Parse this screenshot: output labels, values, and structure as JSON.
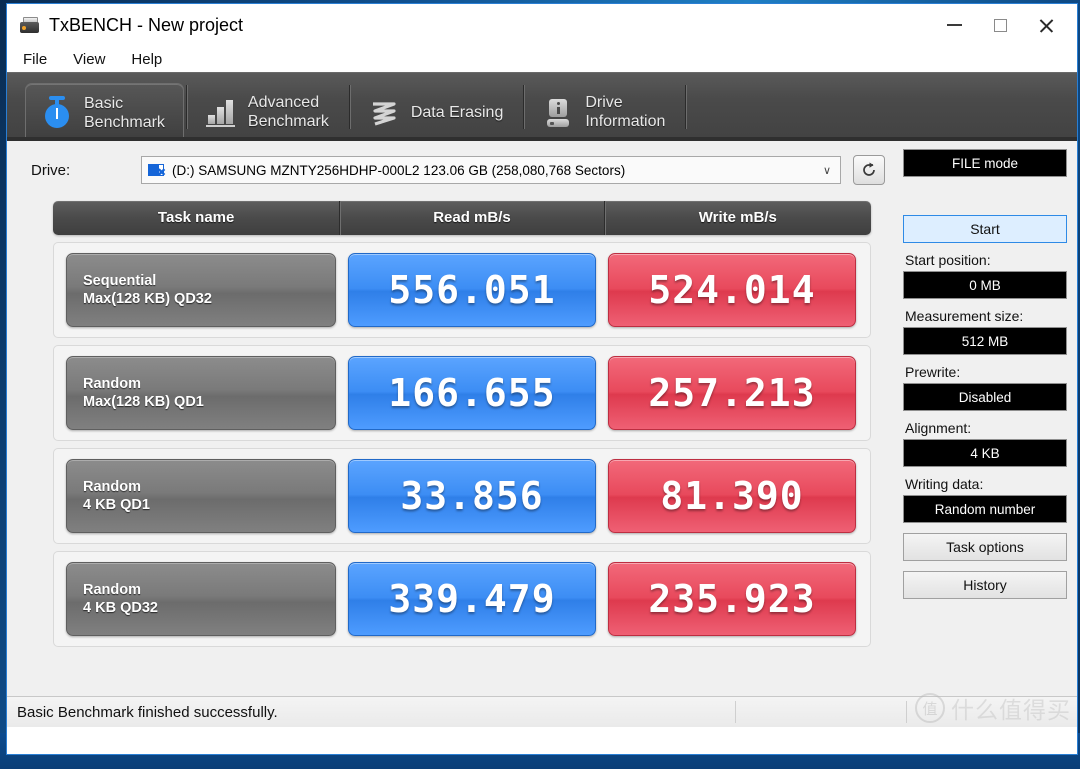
{
  "window": {
    "title": "TxBENCH - New project",
    "app_icon": "drive-icon",
    "controls": {
      "minimize": "minimize-icon",
      "maximize": "maximize-icon",
      "close": "close-icon"
    }
  },
  "menubar": {
    "items": [
      "File",
      "View",
      "Help"
    ]
  },
  "tabs": [
    {
      "label": "Basic\nBenchmark",
      "icon": "stopwatch-icon",
      "active": true
    },
    {
      "label": "Advanced\nBenchmark",
      "icon": "bar-chart-icon",
      "active": false
    },
    {
      "label": "Data Erasing",
      "icon": "erase-icon",
      "active": false
    },
    {
      "label": "Drive\nInformation",
      "icon": "drive-info-icon",
      "active": false
    }
  ],
  "drive": {
    "label": "Drive:",
    "selected": "(D:) SAMSUNG MZNTY256HDHP-000L2  123.06 GB (258,080,768 Sectors)",
    "caret": "∨",
    "refresh_icon": "refresh-icon"
  },
  "table": {
    "headers": [
      "Task name",
      "Read mB/s",
      "Write mB/s"
    ],
    "rows": [
      {
        "name_line1": "Sequential",
        "name_line2": "Max(128 KB) QD32",
        "read": "556.051",
        "write": "524.014"
      },
      {
        "name_line1": "Random",
        "name_line2": "Max(128 KB) QD1",
        "read": "166.655",
        "write": "257.213"
      },
      {
        "name_line1": "Random",
        "name_line2": "4 KB QD1",
        "read": "33.856",
        "write": "81.390"
      },
      {
        "name_line1": "Random",
        "name_line2": "4 KB QD32",
        "read": "339.479",
        "write": "235.923"
      }
    ]
  },
  "sidebar": {
    "file_mode": "FILE mode",
    "start": "Start",
    "fields": [
      {
        "label": "Start position:",
        "value": "0 MB"
      },
      {
        "label": "Measurement size:",
        "value": "512 MB"
      },
      {
        "label": "Prewrite:",
        "value": "Disabled"
      },
      {
        "label": "Alignment:",
        "value": "4 KB"
      },
      {
        "label": "Writing data:",
        "value": "Random number"
      }
    ],
    "task_options": "Task options",
    "history": "History"
  },
  "statusbar": {
    "message": "Basic Benchmark finished successfully."
  },
  "watermark": {
    "badge": "值",
    "text": "什么值得买"
  },
  "colors": {
    "read_bar": "#3c8df4",
    "write_bar": "#e8495c",
    "accent_tab_icon": "#2b8ef0",
    "start_button_border": "#2e8ae6",
    "window_border": "#2a7fd4"
  }
}
